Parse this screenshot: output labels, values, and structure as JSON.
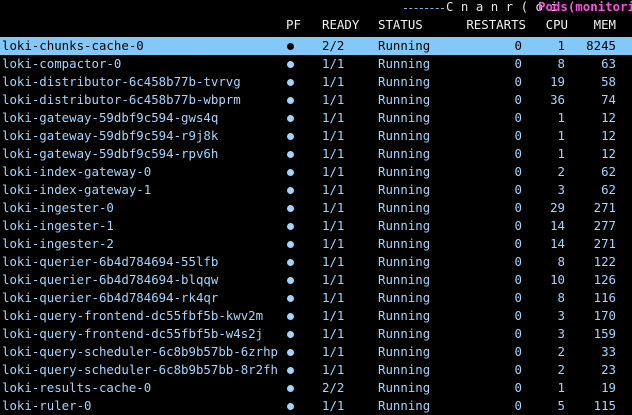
{
  "topbar": {
    "keys": "C n a n r ( o i",
    "title": "Pods(monitoring)"
  },
  "columns": {
    "pf": "PF",
    "ready": "READY",
    "status": "STATUS",
    "restarts": "RESTARTS",
    "cpu": "CPU",
    "mem": "MEM"
  },
  "rows": [
    {
      "name": "loki-chunks-cache-0",
      "ready": "2/2",
      "status": "Running",
      "restarts": "0",
      "cpu": "1",
      "mem": "8245"
    },
    {
      "name": "loki-compactor-0",
      "ready": "1/1",
      "status": "Running",
      "restarts": "0",
      "cpu": "8",
      "mem": "63"
    },
    {
      "name": "loki-distributor-6c458b77b-tvrvg",
      "ready": "1/1",
      "status": "Running",
      "restarts": "0",
      "cpu": "19",
      "mem": "58"
    },
    {
      "name": "loki-distributor-6c458b77b-wbprm",
      "ready": "1/1",
      "status": "Running",
      "restarts": "0",
      "cpu": "36",
      "mem": "74"
    },
    {
      "name": "loki-gateway-59dbf9c594-gws4q",
      "ready": "1/1",
      "status": "Running",
      "restarts": "0",
      "cpu": "1",
      "mem": "12"
    },
    {
      "name": "loki-gateway-59dbf9c594-r9j8k",
      "ready": "1/1",
      "status": "Running",
      "restarts": "0",
      "cpu": "1",
      "mem": "12"
    },
    {
      "name": "loki-gateway-59dbf9c594-rpv6h",
      "ready": "1/1",
      "status": "Running",
      "restarts": "0",
      "cpu": "1",
      "mem": "12"
    },
    {
      "name": "loki-index-gateway-0",
      "ready": "1/1",
      "status": "Running",
      "restarts": "0",
      "cpu": "2",
      "mem": "62"
    },
    {
      "name": "loki-index-gateway-1",
      "ready": "1/1",
      "status": "Running",
      "restarts": "0",
      "cpu": "3",
      "mem": "62"
    },
    {
      "name": "loki-ingester-0",
      "ready": "1/1",
      "status": "Running",
      "restarts": "0",
      "cpu": "29",
      "mem": "271"
    },
    {
      "name": "loki-ingester-1",
      "ready": "1/1",
      "status": "Running",
      "restarts": "0",
      "cpu": "14",
      "mem": "277"
    },
    {
      "name": "loki-ingester-2",
      "ready": "1/1",
      "status": "Running",
      "restarts": "0",
      "cpu": "14",
      "mem": "271"
    },
    {
      "name": "loki-querier-6b4d784694-55lfb",
      "ready": "1/1",
      "status": "Running",
      "restarts": "0",
      "cpu": "8",
      "mem": "122"
    },
    {
      "name": "loki-querier-6b4d784694-blqqw",
      "ready": "1/1",
      "status": "Running",
      "restarts": "0",
      "cpu": "10",
      "mem": "126"
    },
    {
      "name": "loki-querier-6b4d784694-rk4qr",
      "ready": "1/1",
      "status": "Running",
      "restarts": "0",
      "cpu": "8",
      "mem": "116"
    },
    {
      "name": "loki-query-frontend-dc55fbf5b-kwv2m",
      "ready": "1/1",
      "status": "Running",
      "restarts": "0",
      "cpu": "3",
      "mem": "170"
    },
    {
      "name": "loki-query-frontend-dc55fbf5b-w4s2j",
      "ready": "1/1",
      "status": "Running",
      "restarts": "0",
      "cpu": "3",
      "mem": "159"
    },
    {
      "name": "loki-query-scheduler-6c8b9b57bb-6zrhp",
      "ready": "1/1",
      "status": "Running",
      "restarts": "0",
      "cpu": "2",
      "mem": "33"
    },
    {
      "name": "loki-query-scheduler-6c8b9b57bb-8r2fh",
      "ready": "1/1",
      "status": "Running",
      "restarts": "0",
      "cpu": "2",
      "mem": "23"
    },
    {
      "name": "loki-results-cache-0",
      "ready": "2/2",
      "status": "Running",
      "restarts": "0",
      "cpu": "1",
      "mem": "19"
    },
    {
      "name": "loki-ruler-0",
      "ready": "1/1",
      "status": "Running",
      "restarts": "0",
      "cpu": "5",
      "mem": "115"
    }
  ],
  "selected_index": 0,
  "colors": {
    "text": "#9fd6ff",
    "selected_bg": "#82c8f8",
    "header": "#f2f2f2",
    "title": "#ff4fe2"
  }
}
